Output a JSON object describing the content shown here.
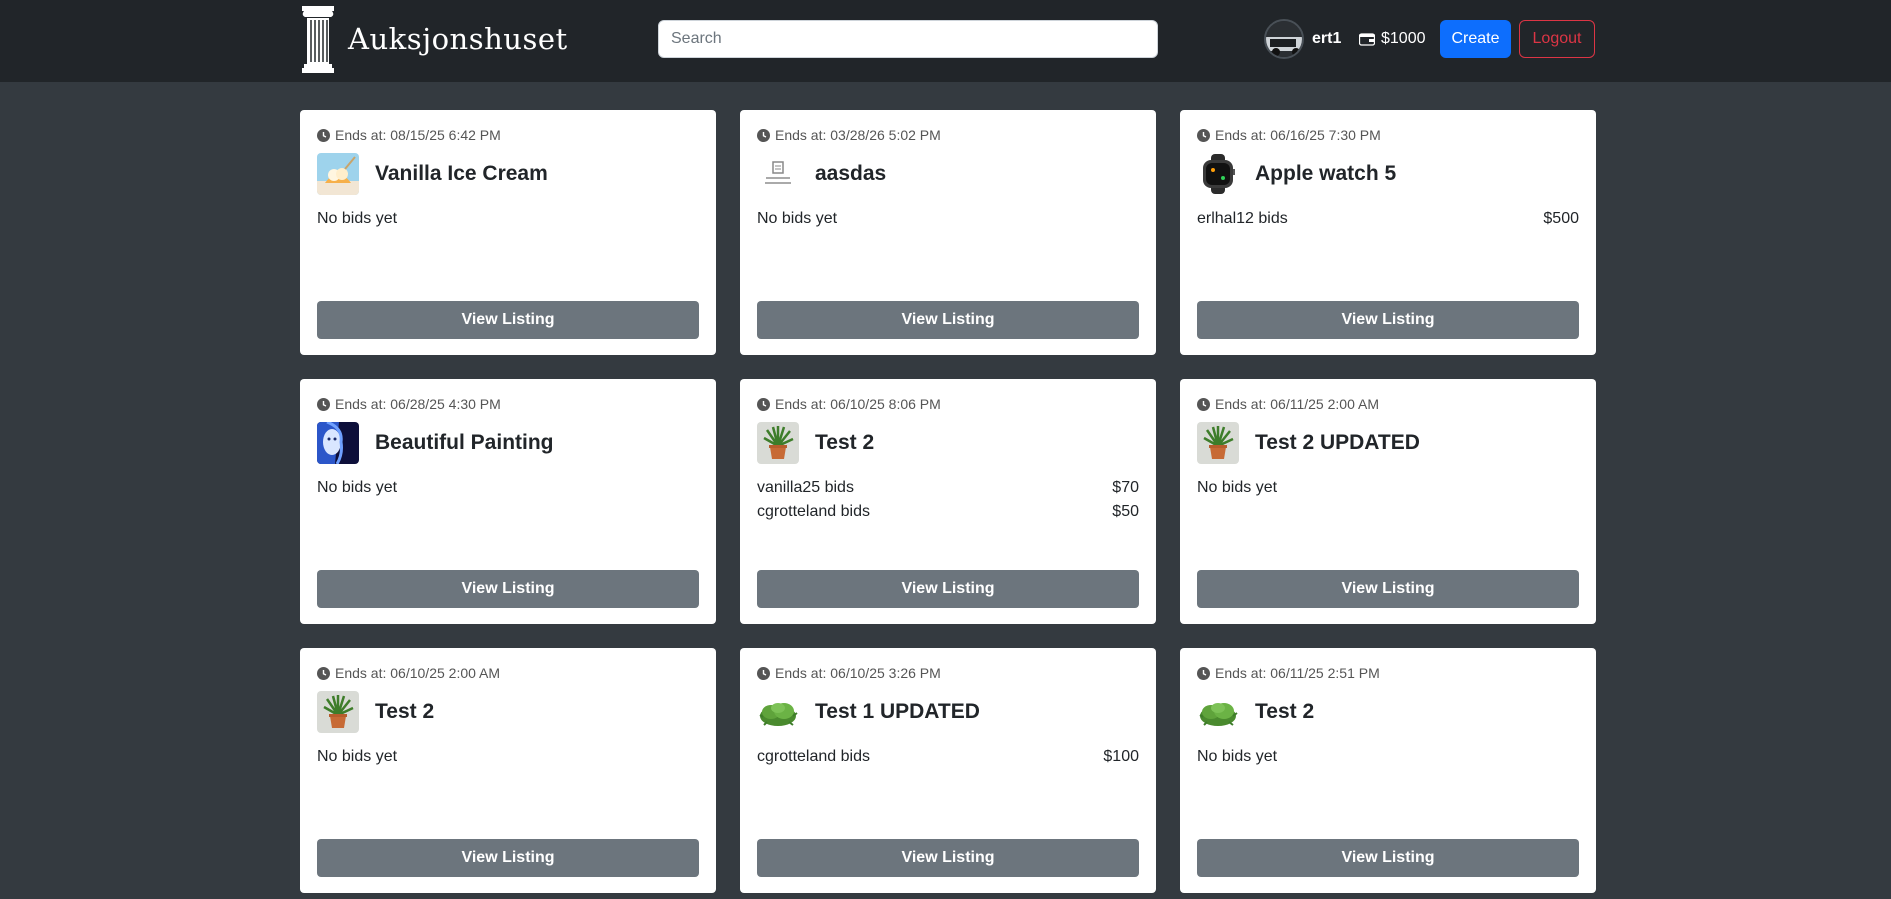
{
  "app": {
    "title": "Auksjonshuset"
  },
  "search": {
    "placeholder": "Search",
    "value": ""
  },
  "user": {
    "name": "ert1",
    "balance": "$1000"
  },
  "buttons": {
    "create": "Create",
    "logout": "Logout"
  },
  "colors": {
    "navbar": "#212529",
    "background": "#343a40",
    "primary": "#0d6efd",
    "danger": "#dc3545",
    "secondary": "#6c757d"
  },
  "ends_prefix": "Ends at: ",
  "view_label": "View Listing",
  "listings": [
    {
      "ends": "08/15/25 6:42 PM",
      "title": "Vanilla Ice Cream",
      "thumb": "ice-cream-icon",
      "bids": [
        {
          "label": "No bids yet",
          "amount": ""
        }
      ]
    },
    {
      "ends": "03/28/26 5:02 PM",
      "title": "aasdas",
      "thumb": "no-image-icon",
      "bids": [
        {
          "label": "No bids yet",
          "amount": ""
        }
      ]
    },
    {
      "ends": "06/16/25 7:30 PM",
      "title": "Apple watch 5",
      "thumb": "watch-icon",
      "bids": [
        {
          "label": "erlhal12 bids",
          "amount": "$500"
        }
      ]
    },
    {
      "ends": "06/28/25 4:30 PM",
      "title": "Beautiful Painting",
      "thumb": "painting-icon",
      "bids": [
        {
          "label": "No bids yet",
          "amount": ""
        }
      ]
    },
    {
      "ends": "06/10/25 8:06 PM",
      "title": "Test 2",
      "thumb": "potted-plant-icon",
      "bids": [
        {
          "label": "vanilla25 bids",
          "amount": "$70"
        },
        {
          "label": "cgrotteland bids",
          "amount": "$50"
        }
      ]
    },
    {
      "ends": "06/11/25 2:00 AM",
      "title": "Test 2 UPDATED",
      "thumb": "potted-plant-icon",
      "bids": [
        {
          "label": "No bids yet",
          "amount": ""
        }
      ]
    },
    {
      "ends": "06/10/25 2:00 AM",
      "title": "Test 2",
      "thumb": "potted-plant-icon",
      "bids": [
        {
          "label": "No bids yet",
          "amount": ""
        }
      ]
    },
    {
      "ends": "06/10/25 3:26 PM",
      "title": "Test 1 UPDATED",
      "thumb": "shrub-icon",
      "bids": [
        {
          "label": "cgrotteland bids",
          "amount": "$100"
        }
      ]
    },
    {
      "ends": "06/11/25 2:51 PM",
      "title": "Test 2",
      "thumb": "shrub-icon",
      "bids": [
        {
          "label": "No bids yet",
          "amount": ""
        }
      ]
    }
  ]
}
